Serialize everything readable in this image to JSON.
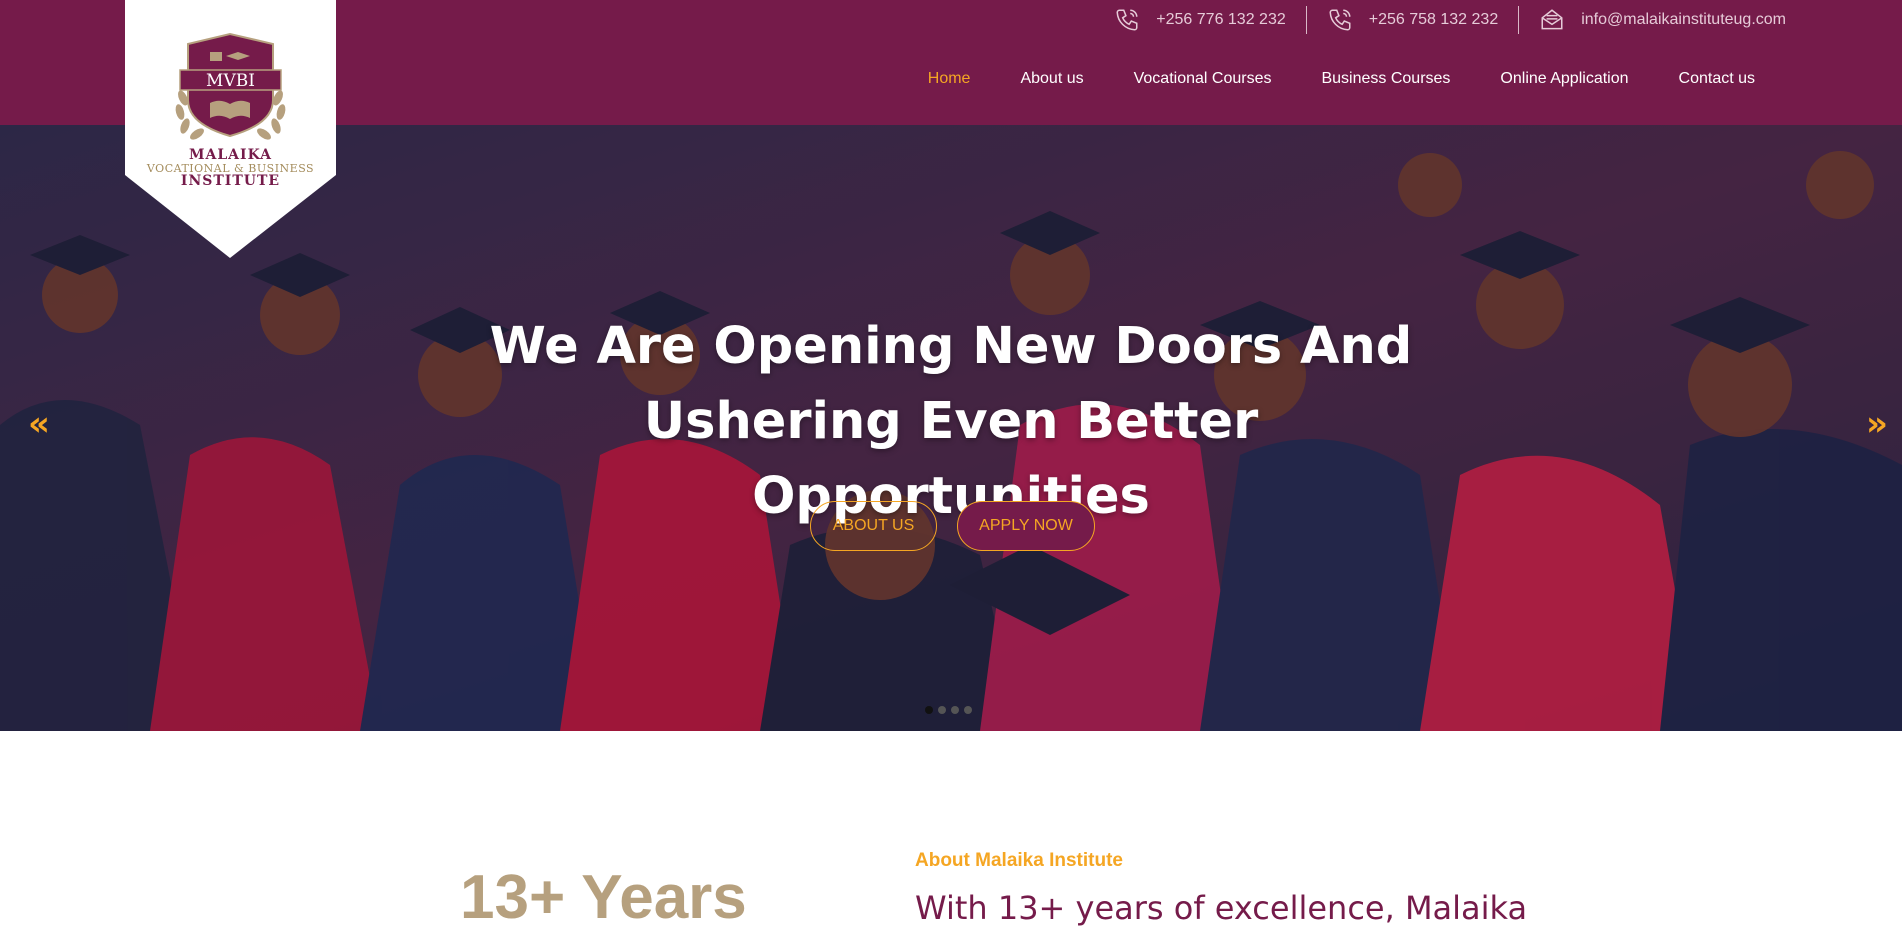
{
  "colors": {
    "brand": "#751b4a",
    "accent": "#f5a623",
    "gold": "#b6a07e"
  },
  "topbar": {
    "phone1": "+256 776 132 232",
    "phone2": "+256 758 132 232",
    "email": "info@malaikainstituteug.com",
    "phone_icon": "phone-icon",
    "email_icon": "mail-icon"
  },
  "logo": {
    "monogram": "MVBI",
    "line1": "MALAIKA",
    "line2": "VOCATIONAL & BUSINESS",
    "line3": "INSTITUTE"
  },
  "nav": {
    "items": [
      {
        "label": "Home",
        "active": true
      },
      {
        "label": "About us"
      },
      {
        "label": "Vocational Courses"
      },
      {
        "label": "Business Courses"
      },
      {
        "label": "Online Application"
      },
      {
        "label": "Contact us"
      }
    ]
  },
  "hero": {
    "title_line1": "We Are Opening New Doors And",
    "title_line2": "Ushering Even Better",
    "title_line3": "Opportunities",
    "about_button": "ABOUT US",
    "apply_button": "APPLY NOW",
    "prev_arrow": "«",
    "next_arrow": "»",
    "slide_count": 4,
    "active_slide": 1
  },
  "about": {
    "years": "13+ Years",
    "label": "About Malaika Institute",
    "heading": "With 13+ years of excellence, Malaika"
  }
}
